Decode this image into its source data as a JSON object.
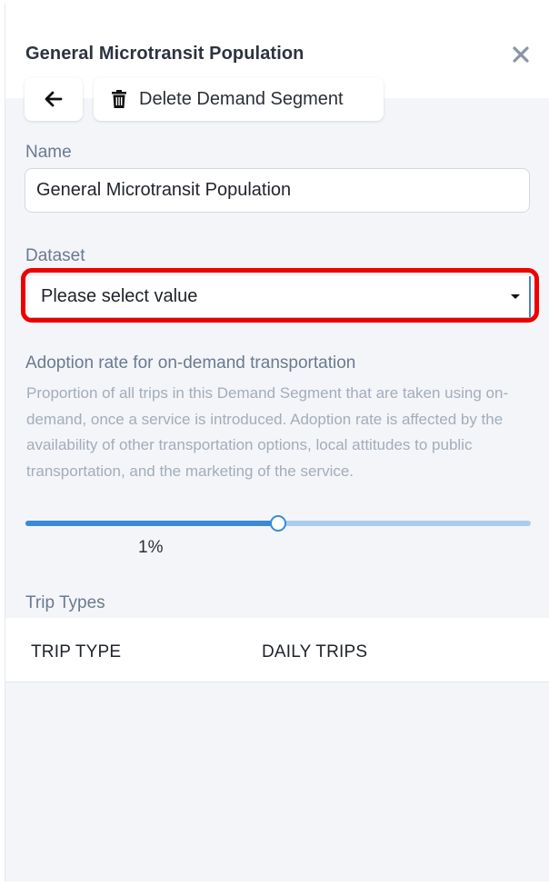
{
  "header": {
    "title": "General Microtransit Population",
    "close_icon": "close-icon",
    "back_icon": "arrow-left-icon",
    "delete_icon": "trash-icon",
    "delete_label": "Delete Demand Segment"
  },
  "form": {
    "name_label": "Name",
    "name_value": "General Microtransit Population",
    "dataset_label": "Dataset",
    "dataset_selected": "Please select value"
  },
  "adoption": {
    "heading": "Adoption rate for on-demand transportation",
    "description": "Proportion of all trips in this Demand Segment that are taken using on-demand, once a service is introduced. Adoption rate is affected by the availability of other transportation options, local attitudes to public transportation, and the marketing of the service.",
    "value_label": "1%",
    "slider_fraction": 0.5
  },
  "trip_types": {
    "label": "Trip Types",
    "columns": [
      "TRIP TYPE",
      "DAILY TRIPS"
    ]
  },
  "colors": {
    "accent": "#3b8ad8",
    "highlight": "#ee0000"
  }
}
